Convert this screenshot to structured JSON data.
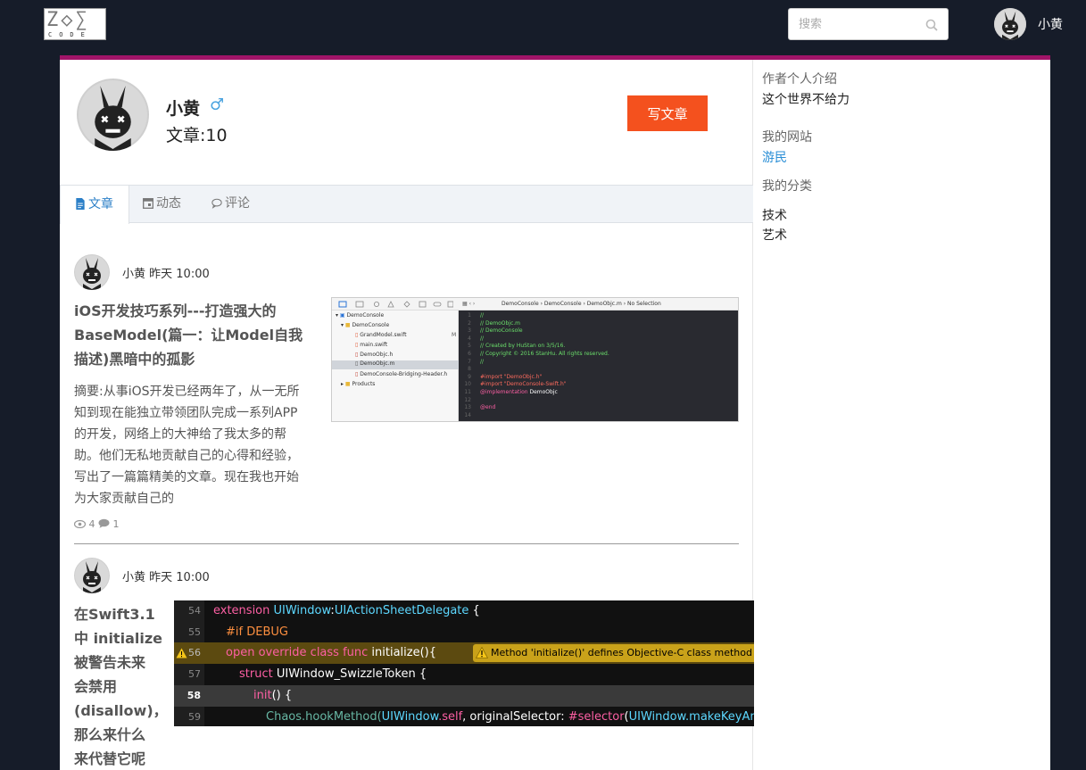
{
  "nav": {
    "logo_mark": "Z◇∑",
    "logo_text": "CODE",
    "search_placeholder": "搜索",
    "user_name": "小黄"
  },
  "profile": {
    "name": "小黄",
    "gender_symbol": "♂",
    "article_count": "文章:10",
    "write_button": "写文章"
  },
  "tabs": [
    {
      "label": "文章",
      "icon": "document-icon",
      "active": true
    },
    {
      "label": "动态",
      "icon": "calendar-icon",
      "active": false
    },
    {
      "label": "评论",
      "icon": "comment-icon",
      "active": false
    }
  ],
  "posts": [
    {
      "author": "小黄",
      "time": "昨天 10:00",
      "title_lines": [
        "iOS开发技巧系列---打造强大的",
        "BaseModel(篇一：让Model自我",
        "描述)黑暗中的孤影"
      ],
      "summary_lines": [
        "摘要:从事iOS开发已经两年了，从一无所",
        "知到现在能独立带领团队完成一系列APP",
        "的开发，网络上的大神给了我太多的帮",
        "助。他们无私地贡献自己的心得和经验，",
        "写出了一篇篇精美的文章。现在我也开始",
        "为大家贡献自己的"
      ],
      "views": "4",
      "comments": "1",
      "image": {
        "breadcrumb": [
          "DemoConsole",
          "DemoConsole",
          "DemoObjc.m",
          "No Selection"
        ],
        "files": [
          "DemoConsole",
          "DemoConsole",
          "GrandModel.swift",
          "main.swift",
          "DemoObjc.h",
          "DemoObjc.m",
          "DemoConsole-Bridging-Header.h",
          "Products"
        ],
        "file_badge": "M",
        "code_lines": [
          "//",
          "//  DemoObjc.m",
          "//  DemoConsole",
          "//",
          "//  Created by HuStan on 3/5/16.",
          "//  Copyright © 2016 StanHu. All rights reserved.",
          "//",
          "",
          "#import \"DemoObjc.h\"",
          "#import \"DemoConsole-Swift.h\"",
          "@implementation DemoObjc",
          "",
          "@end",
          ""
        ]
      }
    },
    {
      "author": "小黄",
      "time": "昨天 10:00",
      "title_lines": [
        "在Swift3.1",
        "中 initialize",
        "被警告未来",
        "会禁用",
        "(disallow)，",
        "那么来什么",
        "来代替它呢"
      ],
      "image": {
        "line_numbers": [
          "54",
          "55",
          "56",
          "57",
          "58",
          "59"
        ],
        "line_1": [
          "extension ",
          "UIWindow",
          ":",
          "UIActionSheetDelegate",
          " {"
        ],
        "line_2": "#if DEBUG",
        "line_3": [
          "open override  class func ",
          "initialize(){"
        ],
        "warning": "Method 'initialize()' defines Objective-C class method 'initi",
        "line_4": [
          "struct ",
          "UIWindow_SwizzleToken {"
        ],
        "line_5": [
          "init",
          "() {"
        ],
        "line_6": [
          "Chaos",
          ".hookMethod(",
          "UIWindow",
          ".self",
          ", originalSelector: ",
          "#selector",
          "(",
          "UIWindow",
          ".makeKeyAndVisible"
        ]
      }
    }
  ],
  "sidebar": {
    "intro_label": "作者个人介绍",
    "intro_value": "这个世界不给力",
    "site_label": "我的网站",
    "site_value": "游民",
    "category_label": "我的分类",
    "categories": [
      "技术",
      "艺术"
    ]
  },
  "colors": {
    "page_bg": "#161c29",
    "accent_bar": "#a01468",
    "write_button": "#f4511e",
    "link": "#2b8fd6",
    "active_tab": "#2b7fc7"
  }
}
